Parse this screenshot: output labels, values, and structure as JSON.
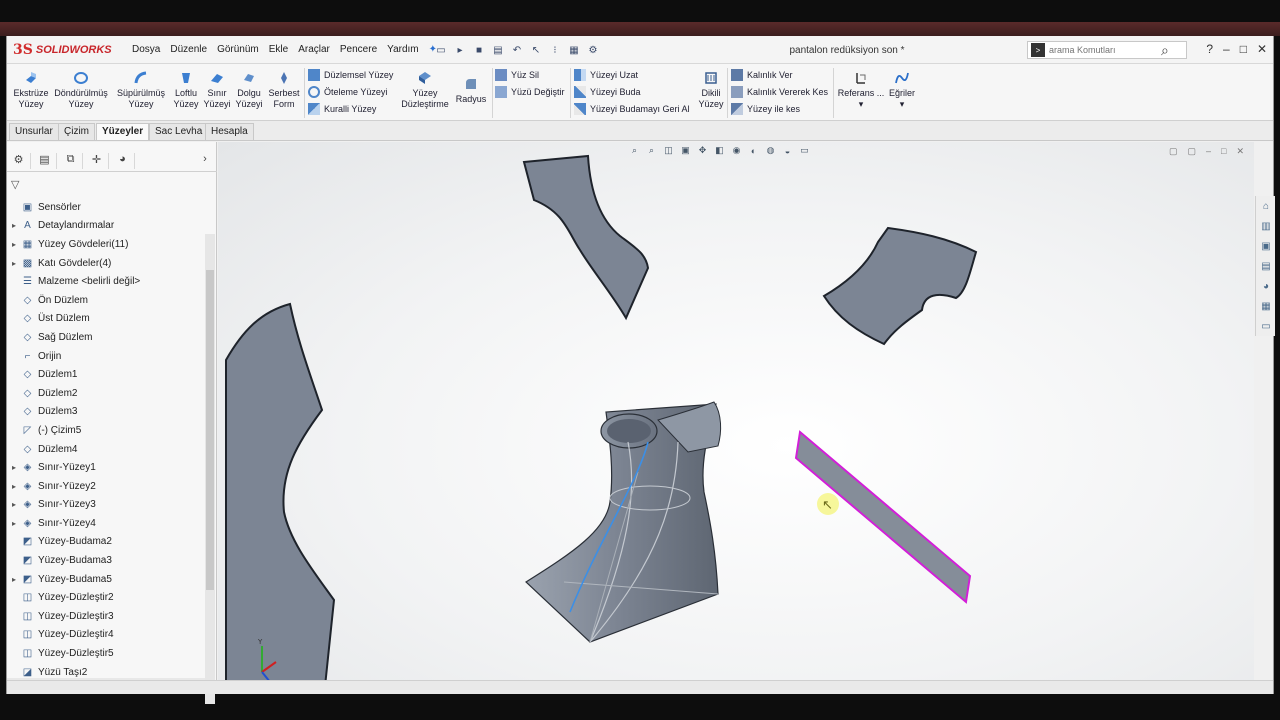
{
  "app": {
    "logo_ds": "3S",
    "logo_text": "SOLIDWORKS",
    "document_title": "pantalon redüksiyon son *"
  },
  "menu": [
    "Dosya",
    "Düzenle",
    "Görünüm",
    "Ekle",
    "Araçlar",
    "Pencere",
    "Yardım"
  ],
  "search": {
    "placeholder": "arama Komutları"
  },
  "window_controls": {
    "help": "?",
    "minimize": "–",
    "maximize": "□",
    "close": "✕"
  },
  "ribbon": {
    "big": [
      {
        "label1": "Ekstrüze",
        "label2": "Yüzey"
      },
      {
        "label1": "Döndürülmüş",
        "label2": "Yüzey"
      },
      {
        "label1": "Süpürülmüş",
        "label2": "Yüzey"
      },
      {
        "label1": "Loftlu",
        "label2": "Yüzey"
      },
      {
        "label1": "Sınır",
        "label2": "Yüzeyi"
      },
      {
        "label1": "Dolgu",
        "label2": "Yüzeyi"
      },
      {
        "label1": "Serbest",
        "label2": "Form"
      }
    ],
    "col1": [
      "Düzlemsel Yüzey",
      "Öteleme Yüzeyi",
      "Kuralli Yüzey"
    ],
    "flatten": {
      "label1": "Yüzey",
      "label2": "Düzleştirme"
    },
    "radius": "Radyus",
    "col2": [
      "Yüz Sil",
      "Yüzü Değiştir"
    ],
    "col3": [
      "Yüzeyi Uzat",
      "Yüzeyi Buda",
      "Yüzeyi Budamayı Geri Al"
    ],
    "ruled": {
      "label1": "Dikili",
      "label2": "Yüzey"
    },
    "col4": [
      "Kalınlık Ver",
      "Kalınlık Vererek Kes",
      "Yüzey ile kes"
    ],
    "reference": "Referans ...",
    "curves": "Eğriler"
  },
  "tabs": [
    "Unsurlar",
    "Çizim",
    "Yüzeyler",
    "Sac Levha",
    "Hesapla"
  ],
  "active_tab": "Yüzeyler",
  "tree": [
    {
      "label": "Sensörler",
      "expand": "",
      "icon": "sensor-icon"
    },
    {
      "label": "Detaylandırmalar",
      "expand": "▸",
      "icon": "annotation-icon"
    },
    {
      "label": "Yüzey Gövdeleri(11)",
      "expand": "▸",
      "icon": "surface-bodies-icon"
    },
    {
      "label": "Katı Gövdeler(4)",
      "expand": "▸",
      "icon": "solid-bodies-icon"
    },
    {
      "label": "Malzeme <belirli değil>",
      "expand": "",
      "icon": "material-icon"
    },
    {
      "label": "Ön Düzlem",
      "expand": "",
      "icon": "plane-icon"
    },
    {
      "label": "Üst Düzlem",
      "expand": "",
      "icon": "plane-icon"
    },
    {
      "label": "Sağ Düzlem",
      "expand": "",
      "icon": "plane-icon"
    },
    {
      "label": "Orijin",
      "expand": "",
      "icon": "origin-icon"
    },
    {
      "label": "Düzlem1",
      "expand": "",
      "icon": "plane-icon"
    },
    {
      "label": "Düzlem2",
      "expand": "",
      "icon": "plane-icon"
    },
    {
      "label": "Düzlem3",
      "expand": "",
      "icon": "plane-icon"
    },
    {
      "label": "(-) Çizim5",
      "expand": "",
      "icon": "sketch-icon"
    },
    {
      "label": "Düzlem4",
      "expand": "",
      "icon": "plane-icon"
    },
    {
      "label": "Sınır-Yüzey1",
      "expand": "▸",
      "icon": "boundary-surface-icon"
    },
    {
      "label": "Sınır-Yüzey2",
      "expand": "▸",
      "icon": "boundary-surface-icon"
    },
    {
      "label": "Sınır-Yüzey3",
      "expand": "▸",
      "icon": "boundary-surface-icon"
    },
    {
      "label": "Sınır-Yüzey4",
      "expand": "▸",
      "icon": "boundary-surface-icon"
    },
    {
      "label": "Yüzey-Budama2",
      "expand": "",
      "icon": "trim-surface-icon"
    },
    {
      "label": "Yüzey-Budama3",
      "expand": "",
      "icon": "trim-surface-icon"
    },
    {
      "label": "Yüzey-Budama5",
      "expand": "▸",
      "icon": "trim-surface-icon"
    },
    {
      "label": "Yüzey-Düzleştir2",
      "expand": "",
      "icon": "flatten-surface-icon"
    },
    {
      "label": "Yüzey-Düzleştir3",
      "expand": "",
      "icon": "flatten-surface-icon"
    },
    {
      "label": "Yüzey-Düzleştir4",
      "expand": "",
      "icon": "flatten-surface-icon"
    },
    {
      "label": "Yüzey-Düzleştir5",
      "expand": "",
      "icon": "flatten-surface-icon"
    },
    {
      "label": "Yüzü Taşı2",
      "expand": "",
      "icon": "move-face-icon"
    }
  ],
  "colors": {
    "part_fill": "#7c8594",
    "part_edge": "#1e232b",
    "selected_edge": "#d21fd8",
    "accent_blue": "#2b6fc9",
    "brand_red": "#c8262b"
  }
}
